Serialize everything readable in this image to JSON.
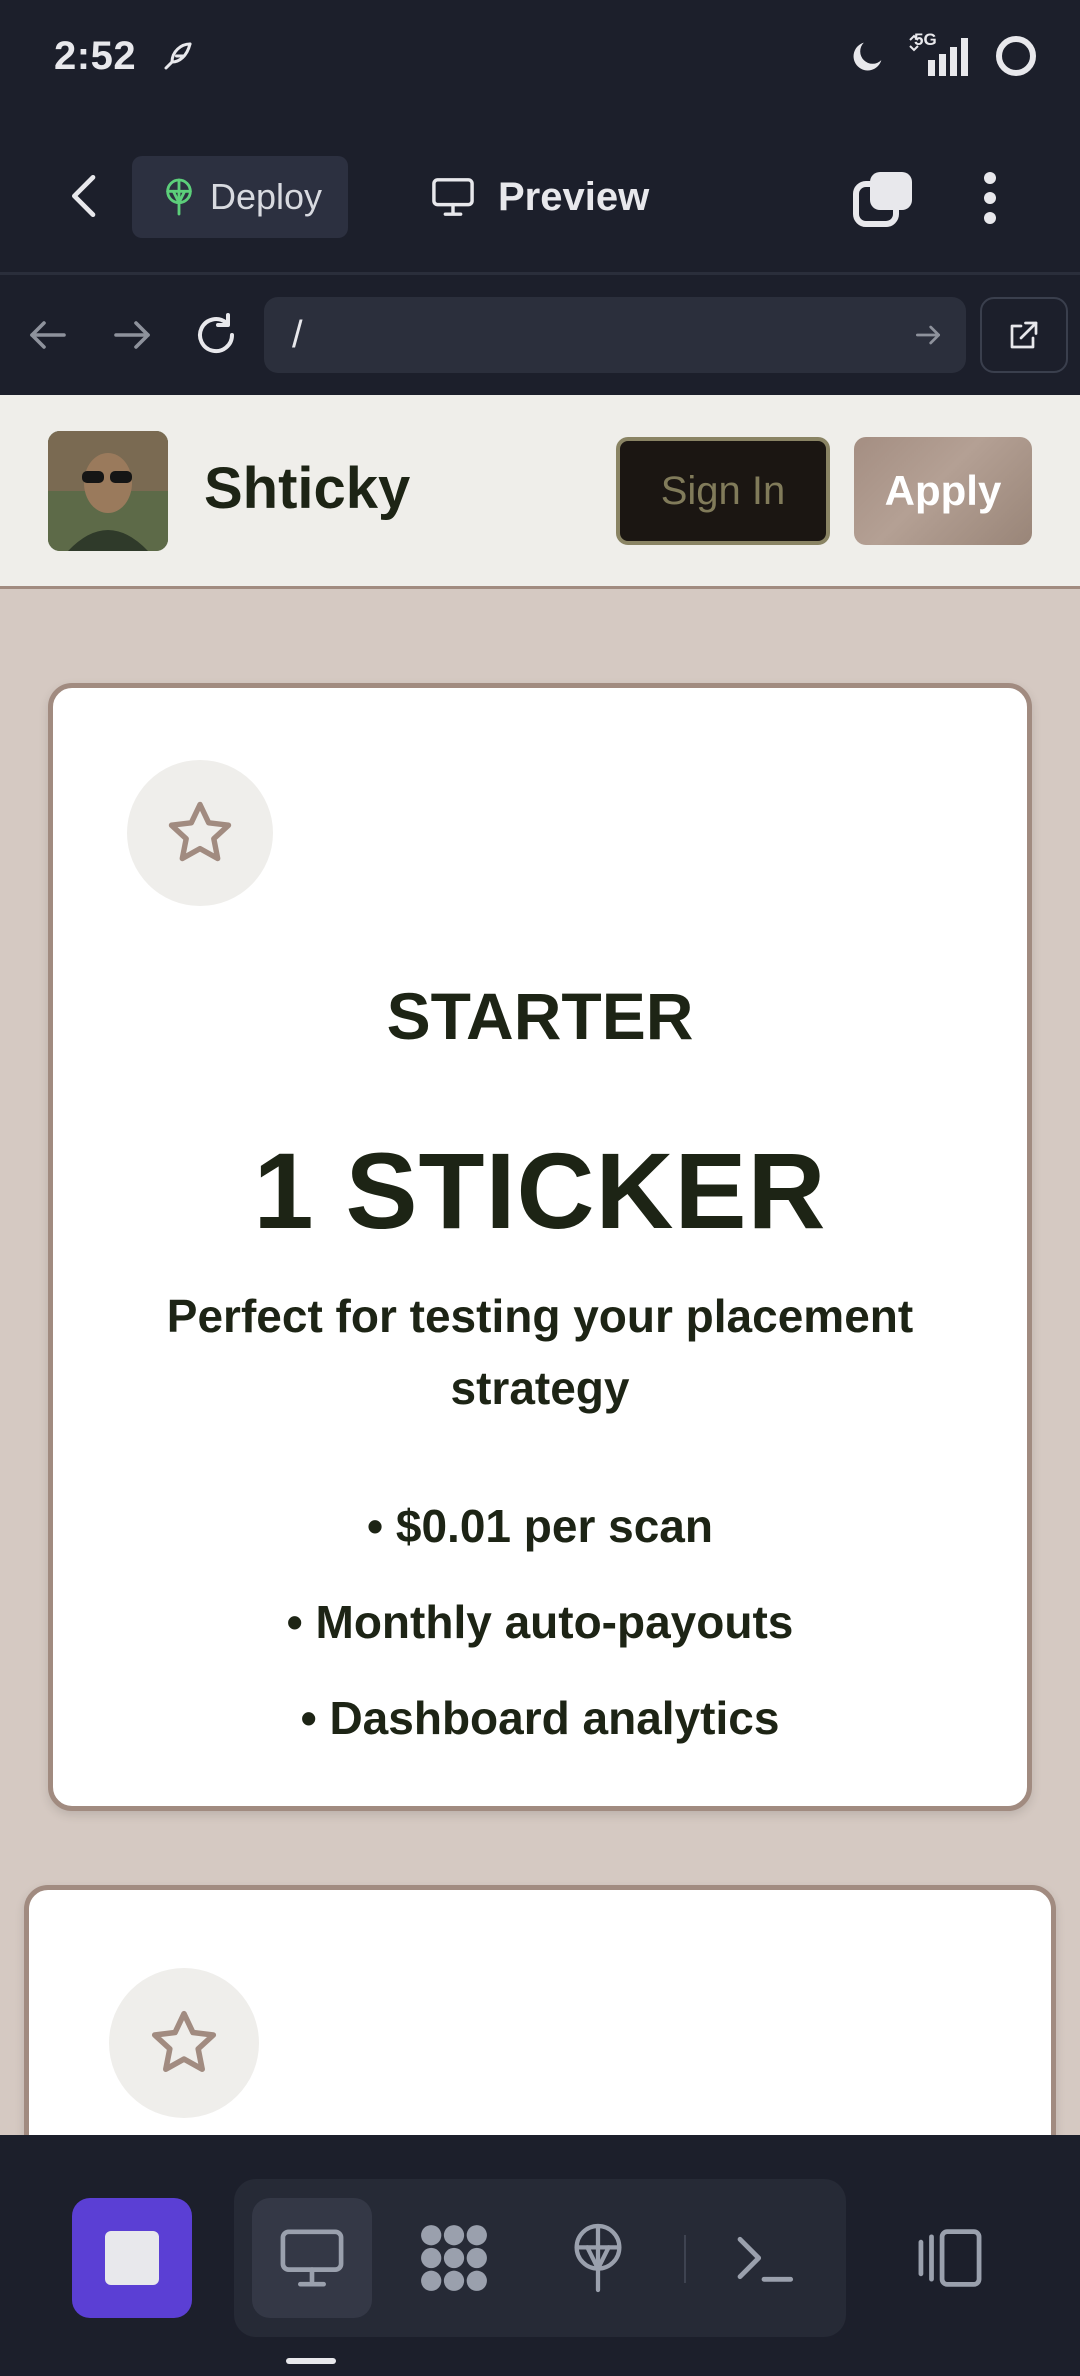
{
  "status_bar": {
    "time": "2:52",
    "network_label": "5G"
  },
  "app_bar": {
    "deploy_label": "Deploy",
    "preview_label": "Preview"
  },
  "url_bar": {
    "url": "/"
  },
  "site": {
    "name": "Shticky",
    "sign_in_label": "Sign In",
    "apply_label": "Apply"
  },
  "plans": [
    {
      "title": "STARTER",
      "price": "1 STICKER",
      "description": "Perfect for testing your placement strategy",
      "features": [
        "• $0.01 per scan",
        "• Monthly auto-payouts",
        "• Dashboard analytics"
      ]
    }
  ],
  "colors": {
    "accent_purple": "#5b3fd4",
    "card_border": "#a18b80",
    "page_background": "#d5c9c2",
    "deploy_icon": "#5ccf7a"
  },
  "icons": {
    "plan_icon": "star-icon",
    "bottom_tools": [
      "desktop-icon",
      "grid-blob-icon",
      "deploy-icon",
      "terminal-icon",
      "device-switch-icon"
    ]
  }
}
